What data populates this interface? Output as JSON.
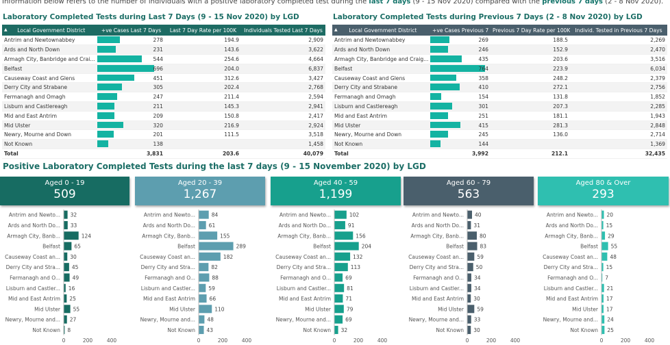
{
  "note": {
    "prefix": "Information below refers to the number of individuals with a positive laboratory completed test during the ",
    "last7": "last 7 days",
    "mid": " (9 - 15 Nov 2020) compared with the ",
    "prev7": "previous 7 days",
    "suffix": " (2 - 8 Nov 2020)."
  },
  "left_table": {
    "title": "Laboratory Completed Tests during Last 7 Days (9 - 15 Nov 2020) by LGD",
    "headers": [
      "Local Government District",
      "+ve Cases Last 7 Days",
      "Last 7 Day Rate per 100K",
      "Individuals Tested Last 7 Days"
    ],
    "header_color": "#1d6b63",
    "rows": [
      [
        "Antrim and Newtownabbey",
        "278",
        "194.9",
        "2,909"
      ],
      [
        "Ards and North Down",
        "231",
        "143.6",
        "3,622"
      ],
      [
        "Armagh City, Banbridge and Crai...",
        "544",
        "254.6",
        "4,664"
      ],
      [
        "Belfast",
        "696",
        "204.0",
        "6,837"
      ],
      [
        "Causeway Coast and Glens",
        "451",
        "312.6",
        "3,427"
      ],
      [
        "Derry City and Strabane",
        "305",
        "202.4",
        "2,768"
      ],
      [
        "Fermanagh and Omagh",
        "247",
        "211.4",
        "2,594"
      ],
      [
        "Lisburn and Castlereagh",
        "211",
        "145.3",
        "2,941"
      ],
      [
        "Mid and East Antrim",
        "209",
        "150.8",
        "2,417"
      ],
      [
        "Mid Ulster",
        "320",
        "216.9",
        "2,924"
      ],
      [
        "Newry, Mourne and Down",
        "201",
        "111.5",
        "3,518"
      ],
      [
        "Not Known",
        "138",
        "",
        "1,458"
      ]
    ],
    "total": [
      "Total",
      "3,831",
      "203.6",
      "40,079"
    ]
  },
  "right_table": {
    "title": "Laboratory Completed Tests during Previous 7 Days (2 - 8 Nov 2020) by LGD",
    "headers": [
      "Local Government District",
      "+ve Cases Previous 7 Days",
      "Previous 7 Day Rate per 100K",
      "Individ. Tested in Previous 7 Days"
    ],
    "header_color": "#4a5f6c",
    "rows": [
      [
        "Antrim and Newtownabbey",
        "269",
        "188.5",
        "2,269"
      ],
      [
        "Ards and North Down",
        "246",
        "152.9",
        "2,470"
      ],
      [
        "Armagh City, Banbridge and Craig...",
        "435",
        "203.6",
        "3,516"
      ],
      [
        "Belfast",
        "764",
        "223.9",
        "6,034"
      ],
      [
        "Causeway Coast and Glens",
        "358",
        "248.2",
        "2,379"
      ],
      [
        "Derry City and Strabane",
        "410",
        "272.1",
        "2,756"
      ],
      [
        "Fermanagh and Omagh",
        "154",
        "131.8",
        "1,852"
      ],
      [
        "Lisburn and Castlereagh",
        "301",
        "207.3",
        "2,285"
      ],
      [
        "Mid and East Antrim",
        "251",
        "181.1",
        "1,943"
      ],
      [
        "Mid Ulster",
        "415",
        "281.3",
        "2,848"
      ],
      [
        "Newry, Mourne and Down",
        "245",
        "136.0",
        "2,714"
      ],
      [
        "Not Known",
        "144",
        "",
        "1,369"
      ]
    ],
    "total": [
      "Total",
      "3,992",
      "212.1",
      "32,435"
    ]
  },
  "section_title": "Positive Laboratory Completed Tests during the last 7 days (9 - 15 November 2020) by LGD",
  "cards": [
    {
      "label": "Aged 0 - 19",
      "value": "509",
      "color": "#176c62"
    },
    {
      "label": "Aged 20 - 39",
      "value": "1,267",
      "color": "#5d9eaf"
    },
    {
      "label": "Aged 40 - 59",
      "value": "1,199",
      "color": "#17a08d"
    },
    {
      "label": "Aged 60 - 79",
      "value": "563",
      "color": "#4a5f6c"
    },
    {
      "label": "Aged 80 & Over",
      "value": "293",
      "color": "#2fbfb0"
    }
  ],
  "chart_data": [
    {
      "type": "bar",
      "title": "Aged 0 - 19",
      "color": "#176c62",
      "xlim": [
        0,
        400
      ],
      "ticks": [
        "0",
        "200",
        "400"
      ],
      "categories": [
        "Antrim and Newto...",
        "Ards and North Do...",
        "Armagh City, Banb...",
        "Belfast",
        "Causeway Coast an...",
        "Derry City and Stra...",
        "Fermanagh and O...",
        "Lisburn and Castler...",
        "Mid and East Antrim",
        "Mid Ulster",
        "Newry, Mourne and...",
        "Not Known"
      ],
      "values": [
        32,
        33,
        124,
        65,
        30,
        45,
        49,
        16,
        25,
        55,
        27,
        8
      ]
    },
    {
      "type": "bar",
      "title": "Aged 20 - 39",
      "color": "#5d9eaf",
      "xlim": [
        0,
        400
      ],
      "ticks": [
        "0",
        "200",
        "400"
      ],
      "categories": [
        "Antrim and Newto...",
        "Ards and North Do...",
        "Armagh City, Banb...",
        "Belfast",
        "Causeway Coast an...",
        "Derry City and Stra...",
        "Fermanagh and O...",
        "Lisburn and Castler...",
        "Mid and East Antrim",
        "Mid Ulster",
        "Newry, Mourne and...",
        "Not Known"
      ],
      "values": [
        84,
        61,
        155,
        289,
        182,
        82,
        88,
        59,
        66,
        110,
        48,
        43
      ]
    },
    {
      "type": "bar",
      "title": "Aged 40 - 59",
      "color": "#17a08d",
      "xlim": [
        0,
        400
      ],
      "ticks": [
        "0",
        "200",
        "400"
      ],
      "categories": [
        "Antrim and Newto...",
        "Ards and North Do...",
        "Armagh City, Banb...",
        "Belfast",
        "Causeway Coast an...",
        "Derry City and Stra...",
        "Fermanagh and O...",
        "Lisburn and Castler...",
        "Mid and East Antrim",
        "Mid Ulster",
        "Newry, Mourne and...",
        "Not Known"
      ],
      "values": [
        102,
        91,
        156,
        204,
        132,
        113,
        69,
        81,
        71,
        79,
        69,
        32
      ]
    },
    {
      "type": "bar",
      "title": "Aged 60 - 79",
      "color": "#4a5f6c",
      "xlim": [
        0,
        400
      ],
      "ticks": [
        "0",
        "200",
        "400"
      ],
      "categories": [
        "Antrim and Newto...",
        "Ards and North Do...",
        "Armagh City, Banb...",
        "Belfast",
        "Causeway Coast an...",
        "Derry City and Stra...",
        "Fermanagh and O...",
        "Lisburn and Castler...",
        "Mid and East Antrim",
        "Mid Ulster",
        "Newry, Mourne and...",
        "Not Known"
      ],
      "values": [
        40,
        31,
        80,
        83,
        59,
        50,
        34,
        34,
        30,
        59,
        33,
        30
      ]
    },
    {
      "type": "bar",
      "title": "Aged 80 & Over",
      "color": "#2fbfb0",
      "xlim": [
        0,
        400
      ],
      "ticks": [
        "0",
        "200",
        "400"
      ],
      "categories": [
        "Antrim and Newto...",
        "Ards and North Do...",
        "Armagh City, Banb...",
        "Belfast",
        "Causeway Coast an...",
        "Derry City and Stra...",
        "Fermanagh and O...",
        "Lisburn and Castler...",
        "Mid and East Antrim",
        "Mid Ulster",
        "Newry, Mourne and...",
        "Not Known"
      ],
      "values": [
        20,
        15,
        29,
        55,
        48,
        15,
        7,
        21,
        17,
        17,
        24,
        25
      ]
    }
  ]
}
